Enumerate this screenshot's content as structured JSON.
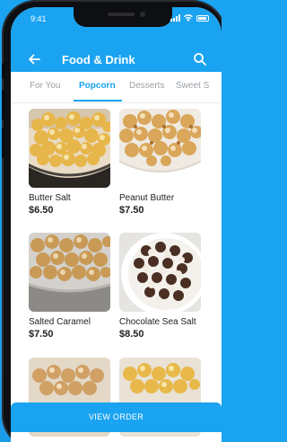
{
  "status_bar": {
    "time": "9:41"
  },
  "header": {
    "title": "Food & Drink"
  },
  "tabs": [
    {
      "label": "For You"
    },
    {
      "label": "Popcorn"
    },
    {
      "label": "Desserts"
    },
    {
      "label": "Sweet S"
    }
  ],
  "active_tab": "Popcorn",
  "products": [
    {
      "name": "Butter Salt",
      "price": "$6.50"
    },
    {
      "name": "Peanut Butter",
      "price": "$7.50"
    },
    {
      "name": "Salted Caramel",
      "price": "$7.50"
    },
    {
      "name": "Chocolate Sea Salt",
      "price": "$8.50"
    }
  ],
  "footer": {
    "view_order_label": "VIEW ORDER"
  },
  "colors": {
    "accent": "#1aa3f0",
    "frame": "#0e0f12"
  }
}
